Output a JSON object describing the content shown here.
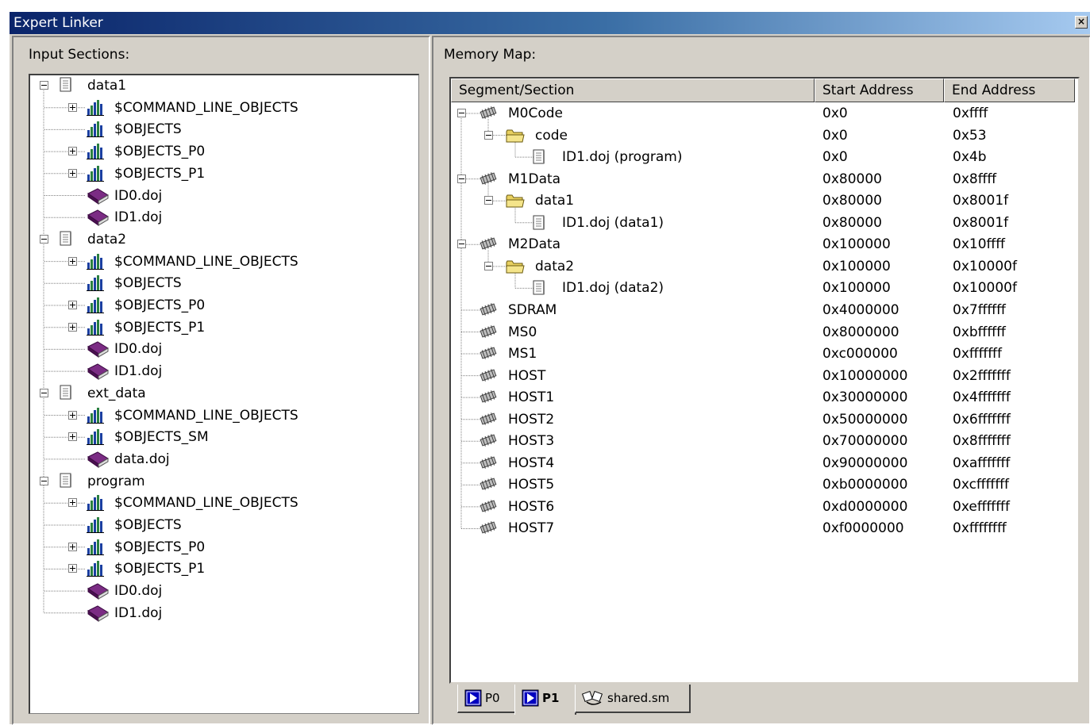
{
  "window": {
    "title": "Expert Linker",
    "close_glyph": "×"
  },
  "left_panel": {
    "label": "Input Sections:",
    "tree": [
      {
        "label": "data1",
        "icon": "document-icon",
        "expander": "minus",
        "level": 0
      },
      {
        "label": "$COMMAND_LINE_OBJECTS",
        "icon": "bar-chart-icon",
        "expander": "plus",
        "level": 1
      },
      {
        "label": "$OBJECTS",
        "icon": "bar-chart-icon",
        "expander": "none",
        "level": 1
      },
      {
        "label": "$OBJECTS_P0",
        "icon": "bar-chart-icon",
        "expander": "plus",
        "level": 1
      },
      {
        "label": "$OBJECTS_P1",
        "icon": "bar-chart-icon",
        "expander": "plus",
        "level": 1
      },
      {
        "label": "ID0.doj",
        "icon": "book-icon",
        "expander": "none",
        "level": 1
      },
      {
        "label": "ID1.doj",
        "icon": "book-icon",
        "expander": "none",
        "level": 1
      },
      {
        "label": "data2",
        "icon": "document-icon",
        "expander": "minus",
        "level": 0
      },
      {
        "label": "$COMMAND_LINE_OBJECTS",
        "icon": "bar-chart-icon",
        "expander": "plus",
        "level": 1
      },
      {
        "label": "$OBJECTS",
        "icon": "bar-chart-icon",
        "expander": "none",
        "level": 1
      },
      {
        "label": "$OBJECTS_P0",
        "icon": "bar-chart-icon",
        "expander": "plus",
        "level": 1
      },
      {
        "label": "$OBJECTS_P1",
        "icon": "bar-chart-icon",
        "expander": "plus",
        "level": 1
      },
      {
        "label": "ID0.doj",
        "icon": "book-icon",
        "expander": "none",
        "level": 1
      },
      {
        "label": "ID1.doj",
        "icon": "book-icon",
        "expander": "none",
        "level": 1
      },
      {
        "label": "ext_data",
        "icon": "document-icon",
        "expander": "minus",
        "level": 0
      },
      {
        "label": "$COMMAND_LINE_OBJECTS",
        "icon": "bar-chart-icon",
        "expander": "plus",
        "level": 1
      },
      {
        "label": "$OBJECTS_SM",
        "icon": "bar-chart-icon",
        "expander": "plus",
        "level": 1
      },
      {
        "label": "data.doj",
        "icon": "book-icon",
        "expander": "none",
        "level": 1
      },
      {
        "label": "program",
        "icon": "document-icon",
        "expander": "minus",
        "level": 0
      },
      {
        "label": "$COMMAND_LINE_OBJECTS",
        "icon": "bar-chart-icon",
        "expander": "plus",
        "level": 1
      },
      {
        "label": "$OBJECTS",
        "icon": "bar-chart-icon",
        "expander": "none",
        "level": 1
      },
      {
        "label": "$OBJECTS_P0",
        "icon": "bar-chart-icon",
        "expander": "plus",
        "level": 1
      },
      {
        "label": "$OBJECTS_P1",
        "icon": "bar-chart-icon",
        "expander": "plus",
        "level": 1
      },
      {
        "label": "ID0.doj",
        "icon": "book-icon",
        "expander": "none",
        "level": 1
      },
      {
        "label": "ID1.doj",
        "icon": "book-icon",
        "expander": "none",
        "level": 1
      }
    ]
  },
  "right_panel": {
    "label": "Memory Map:",
    "columns": [
      "Segment/Section",
      "Start Address",
      "End Address"
    ],
    "rows": [
      {
        "name": "M0Code",
        "start": "0x0",
        "end": "0xffff",
        "icon": "memory-chip-icon",
        "expander": "minus",
        "level": 0
      },
      {
        "name": "code",
        "start": "0x0",
        "end": "0x53",
        "icon": "folder-icon",
        "expander": "minus",
        "level": 1
      },
      {
        "name": "ID1.doj (program)",
        "start": "0x0",
        "end": "0x4b",
        "icon": "document-icon",
        "expander": "none",
        "level": 2
      },
      {
        "name": "M1Data",
        "start": "0x80000",
        "end": "0x8ffff",
        "icon": "memory-chip-icon",
        "expander": "minus",
        "level": 0
      },
      {
        "name": "data1",
        "start": "0x80000",
        "end": "0x8001f",
        "icon": "folder-icon",
        "expander": "minus",
        "level": 1
      },
      {
        "name": "ID1.doj (data1)",
        "start": "0x80000",
        "end": "0x8001f",
        "icon": "document-icon",
        "expander": "none",
        "level": 2
      },
      {
        "name": "M2Data",
        "start": "0x100000",
        "end": "0x10ffff",
        "icon": "memory-chip-icon",
        "expander": "minus",
        "level": 0
      },
      {
        "name": "data2",
        "start": "0x100000",
        "end": "0x10000f",
        "icon": "folder-icon",
        "expander": "minus",
        "level": 1
      },
      {
        "name": "ID1.doj (data2)",
        "start": "0x100000",
        "end": "0x10000f",
        "icon": "document-icon",
        "expander": "none",
        "level": 2
      },
      {
        "name": "SDRAM",
        "start": "0x4000000",
        "end": "0x7ffffff",
        "icon": "memory-chip-icon",
        "expander": "none",
        "level": 0
      },
      {
        "name": "MS0",
        "start": "0x8000000",
        "end": "0xbffffff",
        "icon": "memory-chip-icon",
        "expander": "none",
        "level": 0
      },
      {
        "name": "MS1",
        "start": "0xc000000",
        "end": "0xfffffff",
        "icon": "memory-chip-icon",
        "expander": "none",
        "level": 0
      },
      {
        "name": "HOST",
        "start": "0x10000000",
        "end": "0x2fffffff",
        "icon": "memory-chip-icon",
        "expander": "none",
        "level": 0
      },
      {
        "name": "HOST1",
        "start": "0x30000000",
        "end": "0x4fffffff",
        "icon": "memory-chip-icon",
        "expander": "none",
        "level": 0
      },
      {
        "name": "HOST2",
        "start": "0x50000000",
        "end": "0x6fffffff",
        "icon": "memory-chip-icon",
        "expander": "none",
        "level": 0
      },
      {
        "name": "HOST3",
        "start": "0x70000000",
        "end": "0x8fffffff",
        "icon": "memory-chip-icon",
        "expander": "none",
        "level": 0
      },
      {
        "name": "HOST4",
        "start": "0x90000000",
        "end": "0xafffffff",
        "icon": "memory-chip-icon",
        "expander": "none",
        "level": 0
      },
      {
        "name": "HOST5",
        "start": "0xb0000000",
        "end": "0xcfffffff",
        "icon": "memory-chip-icon",
        "expander": "none",
        "level": 0
      },
      {
        "name": "HOST6",
        "start": "0xd0000000",
        "end": "0xefffffff",
        "icon": "memory-chip-icon",
        "expander": "none",
        "level": 0
      },
      {
        "name": "HOST7",
        "start": "0xf0000000",
        "end": "0xffffffff",
        "icon": "memory-chip-icon",
        "expander": "none",
        "level": 0
      }
    ],
    "tabs": [
      {
        "label": "P0",
        "icon": "processor-icon",
        "active": false
      },
      {
        "label": "P1",
        "icon": "processor-icon",
        "active": true
      },
      {
        "label": "shared.sm",
        "icon": "shared-memory-icon",
        "active": false
      }
    ]
  },
  "colors": {
    "titlebar_start": "#0a246a",
    "titlebar_end": "#a6caf0",
    "face": "#d4d0c8",
    "tab_icon_blue": "#0000c0",
    "book_purple": "#7b2c84",
    "folder_yellow": "#e8d060"
  }
}
